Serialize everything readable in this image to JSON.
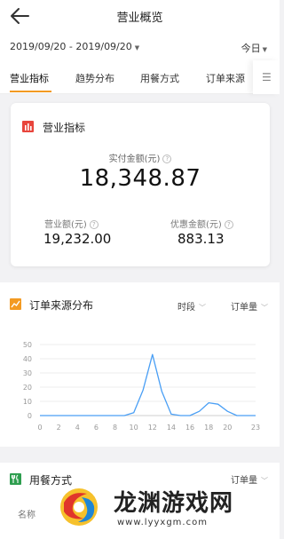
{
  "header": {
    "title": "营业概览",
    "back_icon": "back-arrow-icon"
  },
  "date_filter": {
    "range": "2019/09/20 - 2019/09/20",
    "period": "今日"
  },
  "tabs": [
    {
      "label": "营业指标",
      "active": true
    },
    {
      "label": "趋势分布",
      "active": false
    },
    {
      "label": "用餐方式",
      "active": false
    },
    {
      "label": "订单来源",
      "active": false
    }
  ],
  "metrics_card": {
    "title": "营业指标",
    "paid_label": "实付金额(元)",
    "paid_value": "18,348.87",
    "revenue_label": "营业额(元)",
    "revenue_value": "19,232.00",
    "discount_label": "优惠金额(元)",
    "discount_value": "883.13"
  },
  "order_source": {
    "title": "订单来源分布",
    "dropdown_period": "时段",
    "dropdown_metric": "订单量"
  },
  "dining": {
    "title": "用餐方式",
    "dropdown_metric": "订单量",
    "col_name": "名称"
  },
  "watermark": {
    "text": "龙渊游戏网",
    "url": "www.lyyxgm.com"
  },
  "colors": {
    "accent": "#f39a22",
    "line": "#4a9ff5",
    "icon_red": "#e8453c"
  },
  "chart_data": {
    "type": "line",
    "x": [
      0,
      1,
      2,
      3,
      4,
      5,
      6,
      7,
      8,
      9,
      10,
      11,
      12,
      13,
      14,
      15,
      16,
      17,
      18,
      19,
      20,
      21,
      22,
      23
    ],
    "series": [
      {
        "values": [
          0,
          0,
          0,
          0,
          0,
          0,
          0,
          0,
          0,
          0,
          2,
          18,
          43,
          17,
          1,
          0,
          0,
          3,
          9,
          8,
          3,
          0,
          0,
          0
        ]
      }
    ],
    "xticks": [
      "0",
      "2",
      "4",
      "6",
      "8",
      "10",
      "12",
      "14",
      "16",
      "18",
      "20",
      "23"
    ],
    "xtick_values": [
      0,
      2,
      4,
      6,
      8,
      10,
      12,
      14,
      16,
      18,
      20,
      23
    ],
    "yticks": [
      "0",
      "10",
      "20",
      "30",
      "40",
      "50"
    ],
    "ylim": [
      0,
      50
    ],
    "grid": true,
    "legend": "none"
  }
}
